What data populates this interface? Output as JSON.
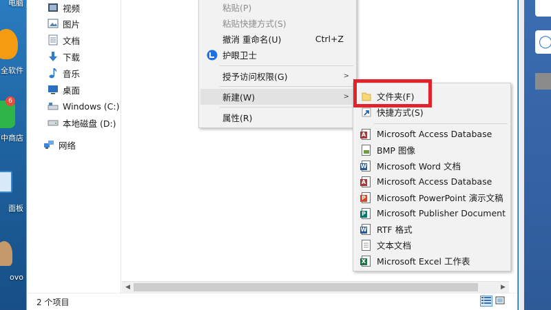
{
  "desktop": {
    "labels": [
      "电脑",
      "全软件",
      "中商店",
      "面板",
      "ovo"
    ],
    "badge_count": "6"
  },
  "nav": {
    "items": [
      {
        "label": "视频",
        "icon": "video-icon"
      },
      {
        "label": "图片",
        "icon": "pictures-icon"
      },
      {
        "label": "文档",
        "icon": "documents-icon"
      },
      {
        "label": "下载",
        "icon": "download-icon"
      },
      {
        "label": "音乐",
        "icon": "music-icon"
      },
      {
        "label": "桌面",
        "icon": "desktop-icon"
      },
      {
        "label": "Windows (C:)",
        "icon": "drive-c-icon"
      },
      {
        "label": "本地磁盘 (D:)",
        "icon": "drive-d-icon"
      },
      {
        "label": "网络",
        "icon": "network-icon"
      }
    ]
  },
  "status": {
    "item_count": "2 个项目"
  },
  "context_menu": {
    "paste": "粘贴(P)",
    "paste_shortcut": "粘贴快捷方式(S)",
    "undo": "撤消 重命名(U)",
    "undo_key": "Ctrl+Z",
    "eye_guard": "护眼卫士",
    "grant_access": "授予访问权限(G)",
    "new": "新建(W)",
    "properties": "属性(R)"
  },
  "submenu": {
    "items": [
      {
        "label": "文件夹(F)",
        "icon": "folder-icon"
      },
      {
        "label": "快捷方式(S)",
        "icon": "shortcut-icon"
      },
      {
        "label": "Microsoft Access Database",
        "icon": "access-icon"
      },
      {
        "label": "BMP 图像",
        "icon": "bmp-icon"
      },
      {
        "label": "Microsoft Word 文档",
        "icon": "word-icon"
      },
      {
        "label": "Microsoft Access Database",
        "icon": "access-icon"
      },
      {
        "label": "Microsoft PowerPoint 演示文稿",
        "icon": "powerpoint-icon"
      },
      {
        "label": "Microsoft Publisher Document",
        "icon": "publisher-icon"
      },
      {
        "label": "RTF 格式",
        "icon": "rtf-icon"
      },
      {
        "label": "文本文档",
        "icon": "text-document-icon"
      },
      {
        "label": "Microsoft Excel 工作表",
        "icon": "excel-icon"
      }
    ]
  },
  "colors": {
    "highlight": "#e0242b",
    "folder": "#f7d777",
    "word": "#2b5797",
    "access": "#a4373a",
    "powerpoint": "#d24726",
    "publisher": "#077568",
    "excel": "#217346"
  }
}
